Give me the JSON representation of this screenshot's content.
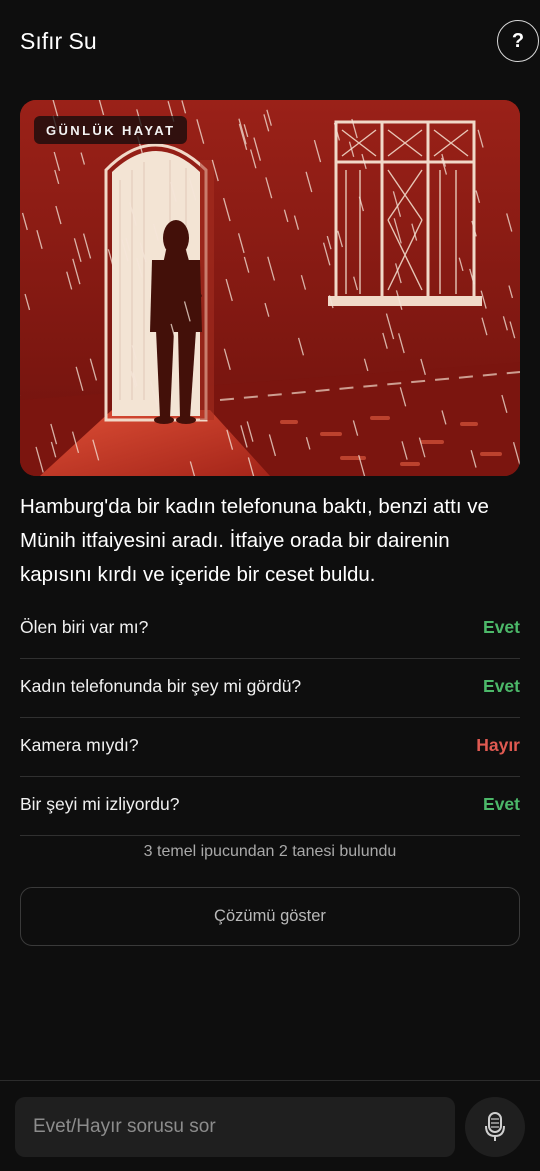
{
  "header": {
    "title": "Sıfır Su",
    "help_label": "?"
  },
  "hero": {
    "category": "GÜNLÜK HAYAT",
    "image_icon": "woman-in-doorway-rain-illustration"
  },
  "story": {
    "text": "Hamburg'da bir kadın telefonuna baktı, benzi attı ve Münih itfaiyesini aradı. İtfaiye orada bir dairenin kapısını kırdı ve içeride bir ceset buldu."
  },
  "qa": [
    {
      "question": "Ölen biri var mı?",
      "answer": "Evet",
      "status": "yes"
    },
    {
      "question": "Kadın telefonunda bir şey mi gördü?",
      "answer": "Evet",
      "status": "yes"
    },
    {
      "question": "Kamera mıydı?",
      "answer": "Hayır",
      "status": "no"
    },
    {
      "question": "Bir şeyi mi izliyordu?",
      "answer": "Evet",
      "status": "yes"
    }
  ],
  "progress": {
    "text": "3 temel ipucundan 2 tanesi bulundu"
  },
  "solution": {
    "label": "Çözümü göster"
  },
  "input": {
    "placeholder": "Evet/Hayır sorusu sor",
    "value": ""
  },
  "mic": {
    "icon": "microphone-icon"
  },
  "colors": {
    "background": "#0e0e0e",
    "yes": "#4cb869",
    "no": "#e05a52",
    "hero_red": "#8e1a14"
  }
}
